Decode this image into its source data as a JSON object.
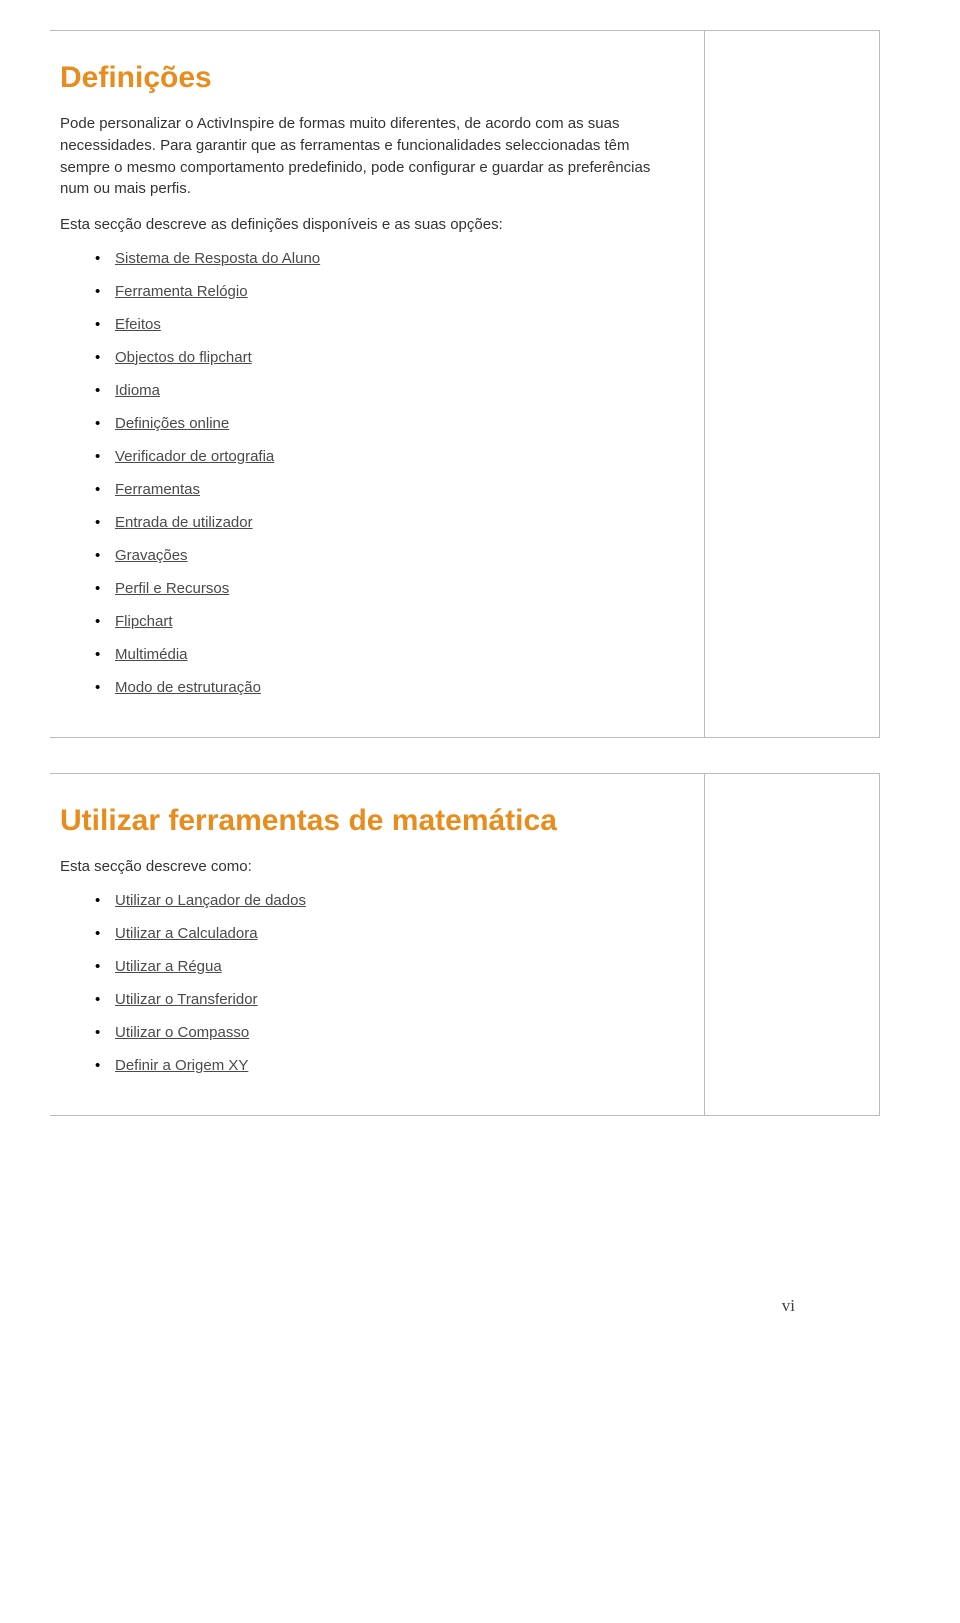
{
  "section1": {
    "title": "Definições",
    "para1": "Pode personalizar o ActivInspire de formas muito diferentes, de acordo com as suas necessidades. Para garantir que as ferramentas e funcionalidades seleccionadas têm sempre o mesmo comportamento predefinido, pode configurar e guardar as preferências num ou mais perfis.",
    "para2": "Esta secção descreve as definições disponíveis e as suas opções:",
    "items": [
      "Sistema de Resposta do Aluno",
      "Ferramenta Relógio",
      "Efeitos",
      "Objectos do flipchart",
      "Idioma",
      "Definições online",
      "Verificador de ortografia",
      "Ferramentas",
      "Entrada de utilizador",
      "Gravações",
      "Perfil e Recursos",
      "Flipchart",
      "Multimédia",
      "Modo de estruturação"
    ]
  },
  "section2": {
    "title": "Utilizar ferramentas de matemática",
    "para1": "Esta secção descreve como:",
    "items": [
      "Utilizar o Lançador de dados",
      "Utilizar a Calculadora",
      "Utilizar a Régua",
      "Utilizar o Transferidor",
      "Utilizar o Compasso",
      "Definir a Origem XY"
    ]
  },
  "pageNumber": "vi"
}
